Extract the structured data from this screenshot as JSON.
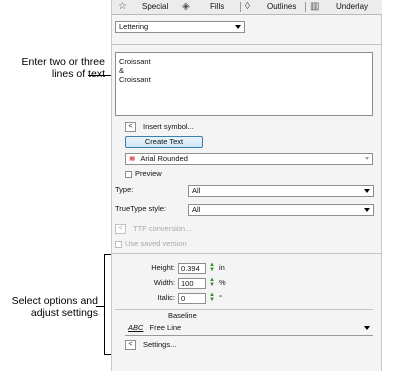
{
  "callouts": {
    "top": "Enter two or three\nlines of text",
    "bottom": "Select options and\nadjust settings"
  },
  "tabs": [
    {
      "label": "Special",
      "icon": "star-icon"
    },
    {
      "label": "Fills",
      "icon": "fill-icon"
    },
    {
      "label": "Outlines",
      "icon": "outline-icon"
    },
    {
      "label": "Underlay",
      "icon": "underlay-icon"
    }
  ],
  "object_type": {
    "value": "Lettering"
  },
  "text_entry": {
    "lines": [
      "Croissant",
      "&",
      "Croissant"
    ]
  },
  "insert_symbol": {
    "button": "<",
    "label": "Insert symbol..."
  },
  "create_text": {
    "label": "Create Text"
  },
  "font": {
    "name": "Arial Rounded",
    "icon_glyph": "≋"
  },
  "preview": {
    "label": "Preview",
    "checked": false
  },
  "type_field": {
    "label": "Type:",
    "value": "All"
  },
  "truetype_style": {
    "label": "TrueType style:",
    "value": "All"
  },
  "ttf_conversion": {
    "button": "<",
    "label": "TTF conversion..."
  },
  "use_saved": {
    "label": "Use saved version",
    "checked": false
  },
  "dimensions": {
    "height": {
      "label": "Height:",
      "value": "0.394",
      "unit": "in"
    },
    "width": {
      "label": "Width:",
      "value": "100",
      "unit": "%"
    },
    "italic": {
      "label": "Italic:",
      "value": "0",
      "unit": "°"
    }
  },
  "baseline": {
    "title": "Baseline",
    "icon_text": "ABC",
    "value": "Free Line"
  },
  "settings": {
    "button": "<",
    "label": "Settings..."
  },
  "colors": {
    "accent": "#3c7fb1",
    "spin_green": "#2e8b22",
    "font_icon": "#d0342c"
  }
}
